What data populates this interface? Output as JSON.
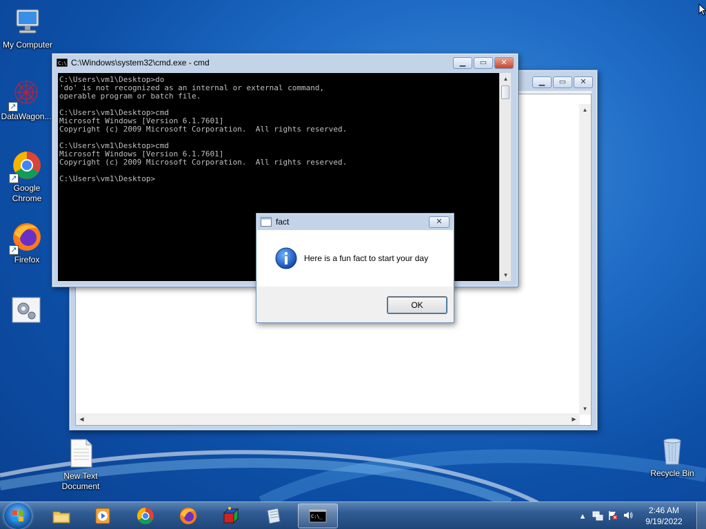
{
  "desktop": {
    "icons": [
      {
        "label": "My Computer",
        "icon": "computer-icon"
      },
      {
        "label": "DataWagon...",
        "icon": "datawagon-icon"
      },
      {
        "label": "Google Chrome",
        "icon": "chrome-icon"
      },
      {
        "label": "Firefox",
        "icon": "firefox-icon"
      },
      {
        "label": "",
        "icon": "settings-tool-icon"
      },
      {
        "label": "New Text Document",
        "icon": "text-document-icon"
      },
      {
        "label": "Recycle Bin",
        "icon": "recycle-bin-icon"
      }
    ]
  },
  "cmd": {
    "title": "C:\\Windows\\system32\\cmd.exe - cmd",
    "lines": [
      "C:\\Users\\vm1\\Desktop>do",
      "'do' is not recognized as an internal or external command,",
      "operable program or batch file.",
      "",
      "C:\\Users\\vm1\\Desktop>cmd",
      "Microsoft Windows [Version 6.1.7601]",
      "Copyright (c) 2009 Microsoft Corporation.  All rights reserved.",
      "",
      "C:\\Users\\vm1\\Desktop>cmd",
      "Microsoft Windows [Version 6.1.7601]",
      "Copyright (c) 2009 Microsoft Corporation.  All rights reserved.",
      "",
      "C:\\Users\\vm1\\Desktop>"
    ]
  },
  "msgbox": {
    "title": "fact",
    "message": "Here is a fun fact to start your day",
    "ok_label": "OK"
  },
  "taskbar": {
    "pinned": [
      "explorer-icon",
      "media-player-icon",
      "chrome-icon",
      "firefox-icon",
      "cube-app-icon",
      "notepad-icon",
      "cmd-icon"
    ],
    "time": "2:46 AM",
    "date": "9/19/2022"
  },
  "colors": {
    "desktop_blue": "#1f6cc6",
    "console_text": "#c0c0c0",
    "window_frame": "#c3d4e9"
  }
}
